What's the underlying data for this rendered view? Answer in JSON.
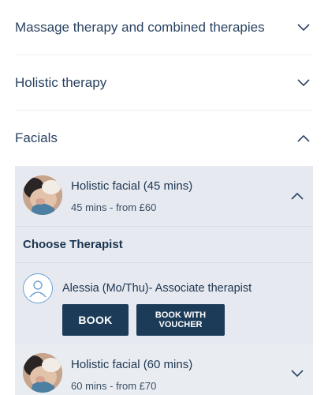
{
  "categories": [
    {
      "label": "Massage therapy and combined therapies",
      "icon": "chevron-down-icon"
    },
    {
      "label": "Holistic therapy",
      "icon": "chevron-down-icon"
    },
    {
      "label": "Facials",
      "icon": "chevron-up-icon"
    }
  ],
  "services": [
    {
      "title": "Holistic facial (45 mins)",
      "subtitle": "45 mins - from £60",
      "icon": "chevron-up-icon"
    },
    {
      "title": "Holistic facial (60 mins)",
      "subtitle": "60 mins - from £70",
      "icon": "chevron-down-icon"
    }
  ],
  "choose_therapist": {
    "title": "Choose Therapist",
    "therapist_name": "Alessia (Mo/Thu)- Associate therapist",
    "book_label": "BOOK",
    "voucher_label": "BOOK WITH VOUCHER"
  },
  "colors": {
    "accent": "#1c3b58",
    "panel": "#e6eaf0",
    "text": "#1c3450"
  }
}
